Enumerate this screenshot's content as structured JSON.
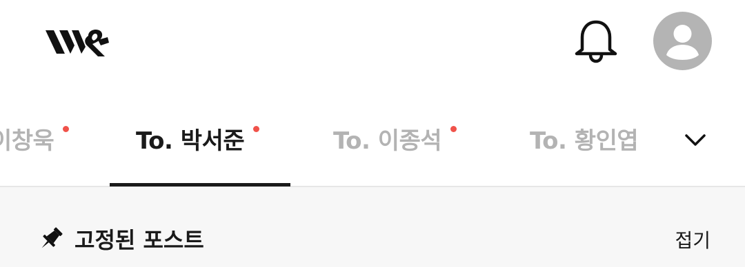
{
  "header": {
    "logo_icon": "brand-logo-icon",
    "bell_icon": "bell-icon",
    "avatar_icon": "user-avatar-icon"
  },
  "tabs": [
    {
      "label": "이창욱",
      "has_new": true,
      "active": false
    },
    {
      "label": "To. 박서준",
      "has_new": true,
      "active": true
    },
    {
      "label": "To. 이종석",
      "has_new": true,
      "active": false
    },
    {
      "label": "To. 황인엽",
      "has_new": false,
      "active": false
    }
  ],
  "tabs_expand_icon": "chevron-down-icon",
  "pinned": {
    "icon": "pin-icon",
    "title": "고정된 포스트",
    "collapse_label": "접기"
  },
  "colors": {
    "accent_dot": "#f0524a",
    "active_text": "#1a1a1a",
    "inactive_text": "#b3b3b3",
    "avatar_bg": "#b4b4b4",
    "pinned_bg": "#f7f7f7"
  }
}
